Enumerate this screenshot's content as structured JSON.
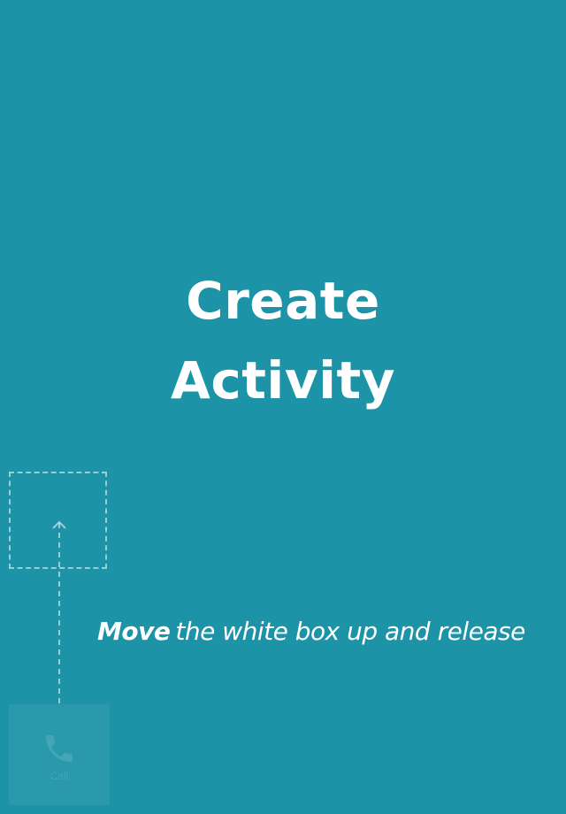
{
  "title": {
    "line1": "Create",
    "line2": "Activity"
  },
  "instruction": {
    "emphasis": "Move",
    "text": "the white box up and release"
  },
  "drag_box": {
    "icon": "phone-icon",
    "label": "Call"
  },
  "colors": {
    "background": "#1c93a6",
    "text": "#ffffff"
  }
}
